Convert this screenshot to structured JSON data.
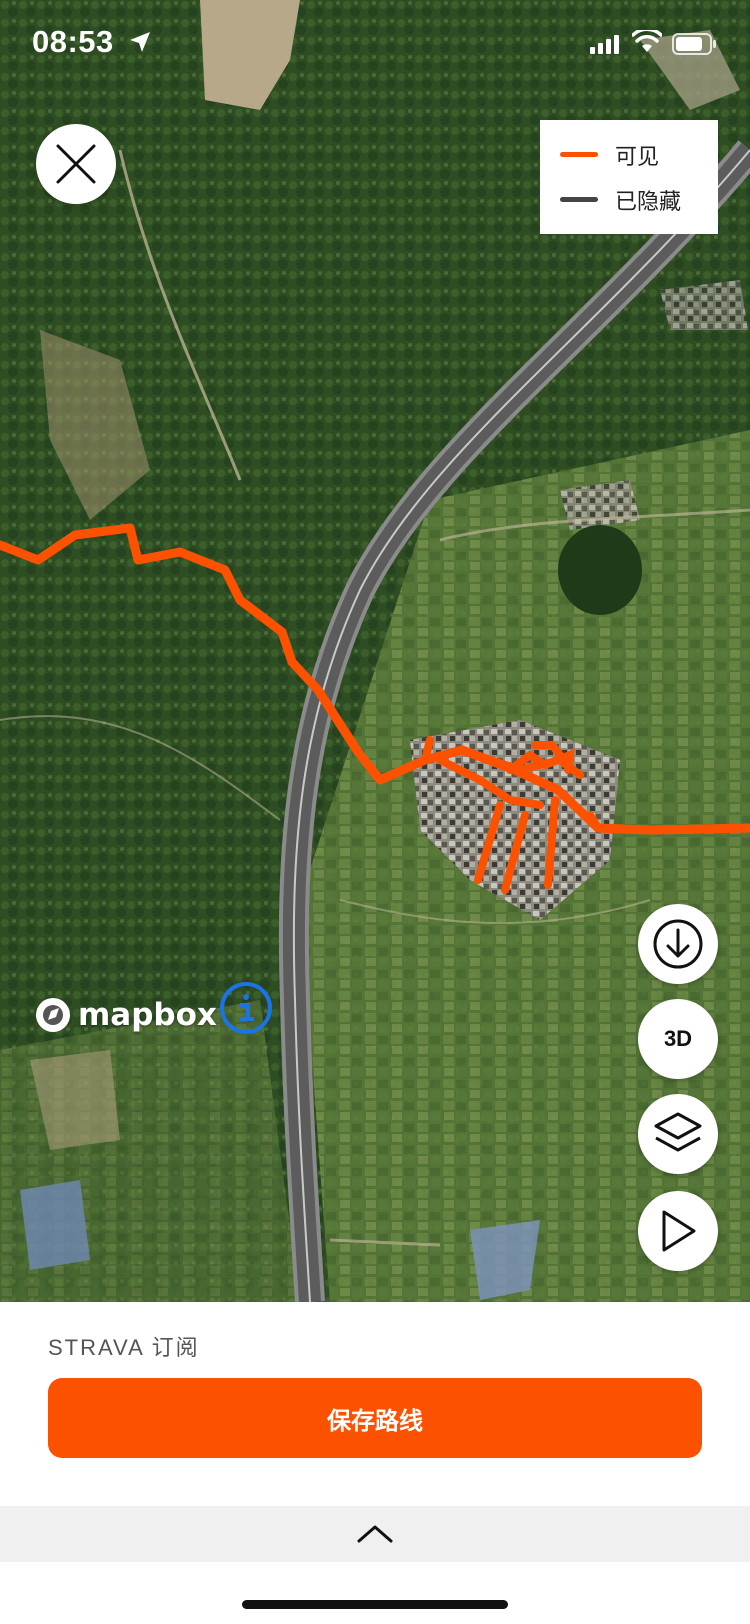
{
  "status_bar": {
    "time": "08:53",
    "location_icon": "location-arrow-icon",
    "signal_icon": "cellular-signal-icon",
    "wifi_icon": "wifi-icon",
    "battery_icon": "battery-icon"
  },
  "map": {
    "close_icon": "close-icon",
    "legend": {
      "items": [
        {
          "label": "可见",
          "color": "#fc5200"
        },
        {
          "label": "已隐藏",
          "color": "#444444"
        }
      ]
    },
    "attribution": {
      "logo_text": "mapbox",
      "info_icon": "info-icon"
    },
    "controls": {
      "download_icon": "download-icon",
      "three_d_label": "3D",
      "layers_icon": "layers-icon",
      "play_icon": "play-icon"
    },
    "route_color": "#fc5200"
  },
  "bottom": {
    "subscription_label": "STRAVA 订阅",
    "save_button_label": "保存路线",
    "drawer_icon": "chevron-up-icon"
  }
}
